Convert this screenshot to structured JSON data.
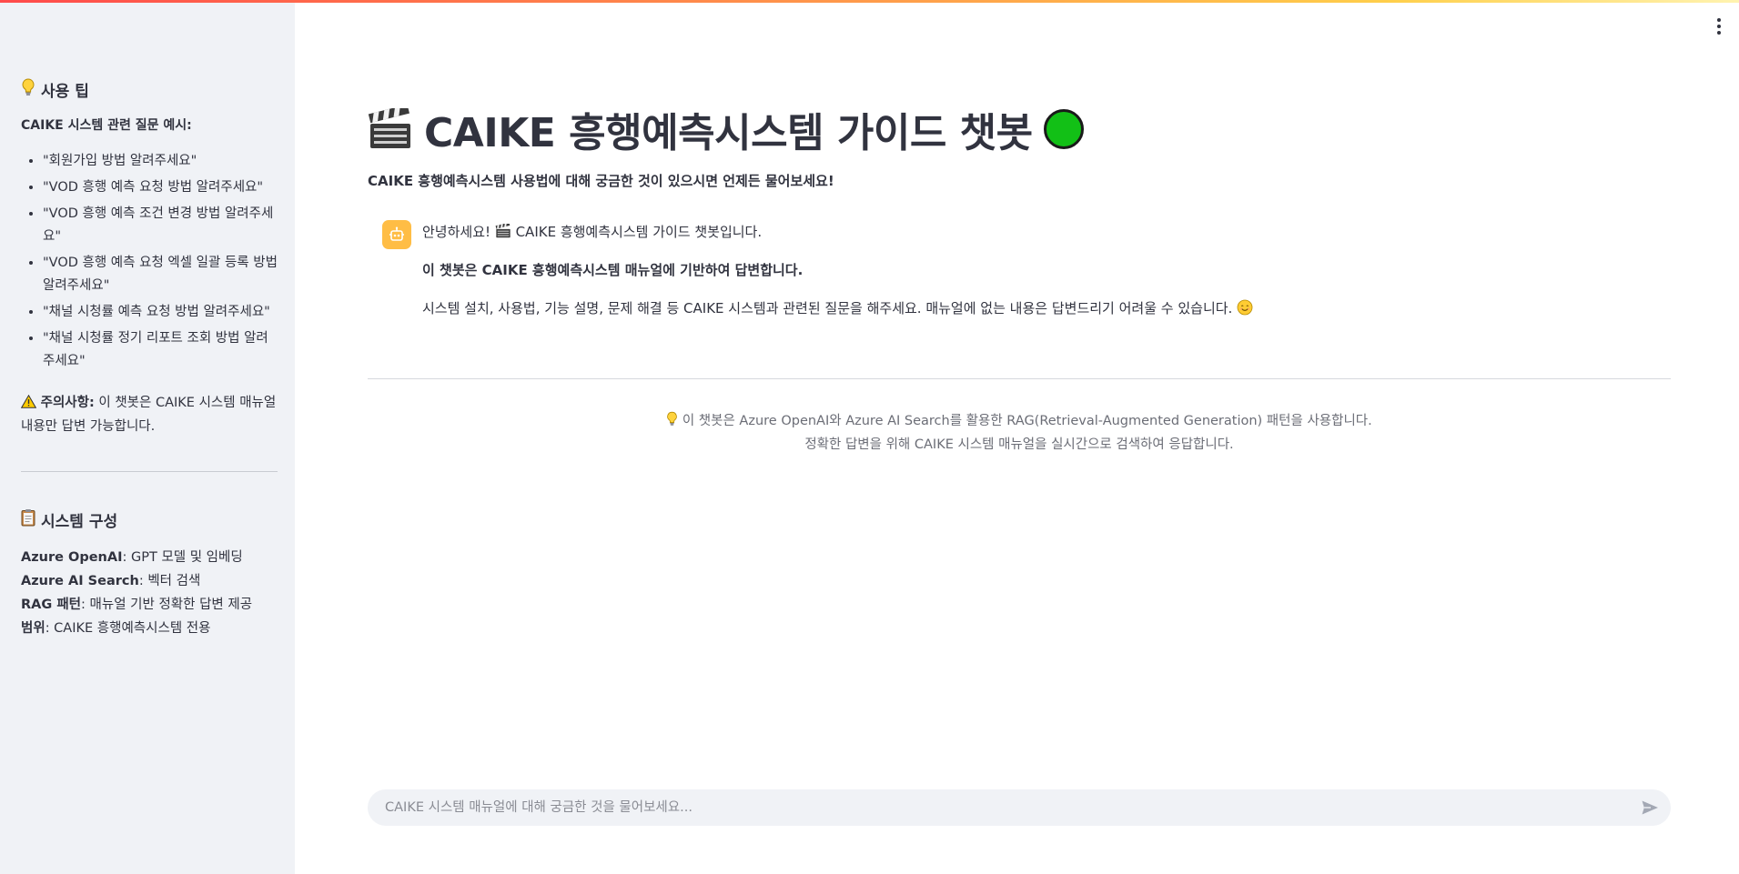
{
  "sidebar": {
    "tips_heading": "사용 팁",
    "tips_sub": "CAIKE 시스템 관련 질문 예시:",
    "examples": [
      "\"회원가입 방법 알려주세요\"",
      "\"VOD 흥행 예측 요청 방법 알려주세요\"",
      "\"VOD 흥행 예측 조건 변경 방법 알려주세요\"",
      "\"VOD 흥행 예측 요청 엑셀 일괄 등록 방법 알려주세요\"",
      "\"채널 시청률 예측 요청 방법 알려주세요\"",
      "\"채널 시청률 정기 리포트 조회 방법 알려주세요\""
    ],
    "warning_label": "주의사항:",
    "warning_text": " 이 챗봇은 CAIKE 시스템 매뉴얼 내용만 답변 가능합니다.",
    "config_heading": "시스템 구성",
    "config": [
      {
        "label": "Azure OpenAI",
        "value": ": GPT 모델 및 임베딩"
      },
      {
        "label": "Azure AI Search",
        "value": ": 벡터 검색"
      },
      {
        "label": "RAG 패턴",
        "value": ": 매뉴얼 기반 정확한 답변 제공"
      },
      {
        "label": "범위",
        "value": ": CAIKE 흥행예측시스템 전용"
      }
    ]
  },
  "main": {
    "title": "CAIKE 흥행예측시스템 가이드 챗봇",
    "subtitle": "CAIKE 흥행예측시스템 사용법에 대해 궁금한 것이 있으시면 언제든 물어보세요!",
    "message": {
      "greeting_prefix": "안녕하세요!",
      "greeting_suffix": "CAIKE 흥행예측시스템 가이드 챗봇입니다.",
      "bold_line": "이 챗봇은 CAIKE 흥행예측시스템 매뉴얼에 기반하여 답변합니다.",
      "info_line": "시스템 설치, 사용법, 기능 설명, 문제 해결 등 CAIKE 시스템과 관련된 질문을 해주세요. 매뉴얼에 없는 내용은 답변드리기 어려울 수 있습니다."
    },
    "footer_line1": "이 챗봇은 Azure OpenAI와 Azure AI Search를 활용한 RAG(Retrieval-Augmented Generation) 패턴을 사용합니다.",
    "footer_line2": "정확한 답변을 위해 CAIKE 시스템 매뉴얼을 실시간으로 검색하여 응답합니다.",
    "input_placeholder": "CAIKE 시스템 매뉴얼에 대해 궁금한 것을 물어보세요..."
  },
  "icons": {
    "tips": "lightbulb-icon",
    "warning": "warning-icon",
    "config": "clipboard-icon",
    "title": "clapperboard-icon",
    "status": "green-circle-icon",
    "avatar": "robot-icon",
    "smile": "smile-icon",
    "send": "send-icon",
    "menu": "more-vertical-icon"
  },
  "colors": {
    "accent_gradient_start": "#ff4b4b",
    "status_green": "#12c016",
    "avatar_bg": "#ffbd45",
    "sidebar_bg": "#f0f2f6"
  }
}
